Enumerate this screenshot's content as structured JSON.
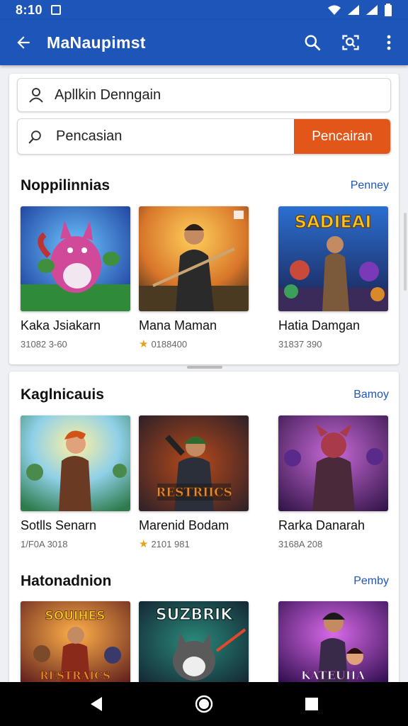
{
  "status": {
    "time": "8:10"
  },
  "appbar": {
    "title": "MaNaupimst"
  },
  "search": {
    "field1_value": "Apllkin Denngain",
    "field2_value": "Pencasian",
    "button_label": "Pencairan"
  },
  "sections": [
    {
      "title": "Noppilinnias",
      "more": "Penney",
      "items": [
        {
          "title": "Kaka Jsiakarn",
          "meta": "31082 3-60",
          "star": false
        },
        {
          "title": "Mana Maman",
          "meta": "0188400",
          "star": true
        },
        {
          "title": "Hatia Damgan",
          "meta": "31837 390",
          "star": false
        }
      ]
    },
    {
      "title": "Kaglnicauis",
      "more": "Bamoy",
      "items": [
        {
          "title": "Sotlls Senarn",
          "meta": "1/F0A 3018",
          "star": false
        },
        {
          "title": "Marenid Bodam",
          "meta": "2101 981",
          "star": true
        },
        {
          "title": "Rarka Danarah",
          "meta": "3168A 208",
          "star": false
        }
      ]
    },
    {
      "title": "Hatonadnion",
      "more": "Pemby",
      "items": [
        {
          "title": "",
          "meta": "",
          "star": false
        },
        {
          "title": "",
          "meta": "",
          "star": false
        },
        {
          "title": "",
          "meta": "",
          "star": false
        }
      ]
    }
  ],
  "thumb_banners": {
    "s1_c3": "SADIEAI",
    "s2_c2": "RESTRIICS",
    "s3_c1_top": "SOUIHES",
    "s3_c1_bottom": "RESTRAICS",
    "s3_c2": "SUZBRIK",
    "s3_c3": "KATEUIIA"
  },
  "colors": {
    "primary": "#1d56b8",
    "accent": "#e2561a"
  },
  "icons": [
    "back-arrow-icon",
    "search-icon",
    "scan-icon",
    "more-vert-icon",
    "user-icon",
    "search-icon",
    "nav-back-icon",
    "nav-home-icon",
    "nav-recents-icon"
  ]
}
